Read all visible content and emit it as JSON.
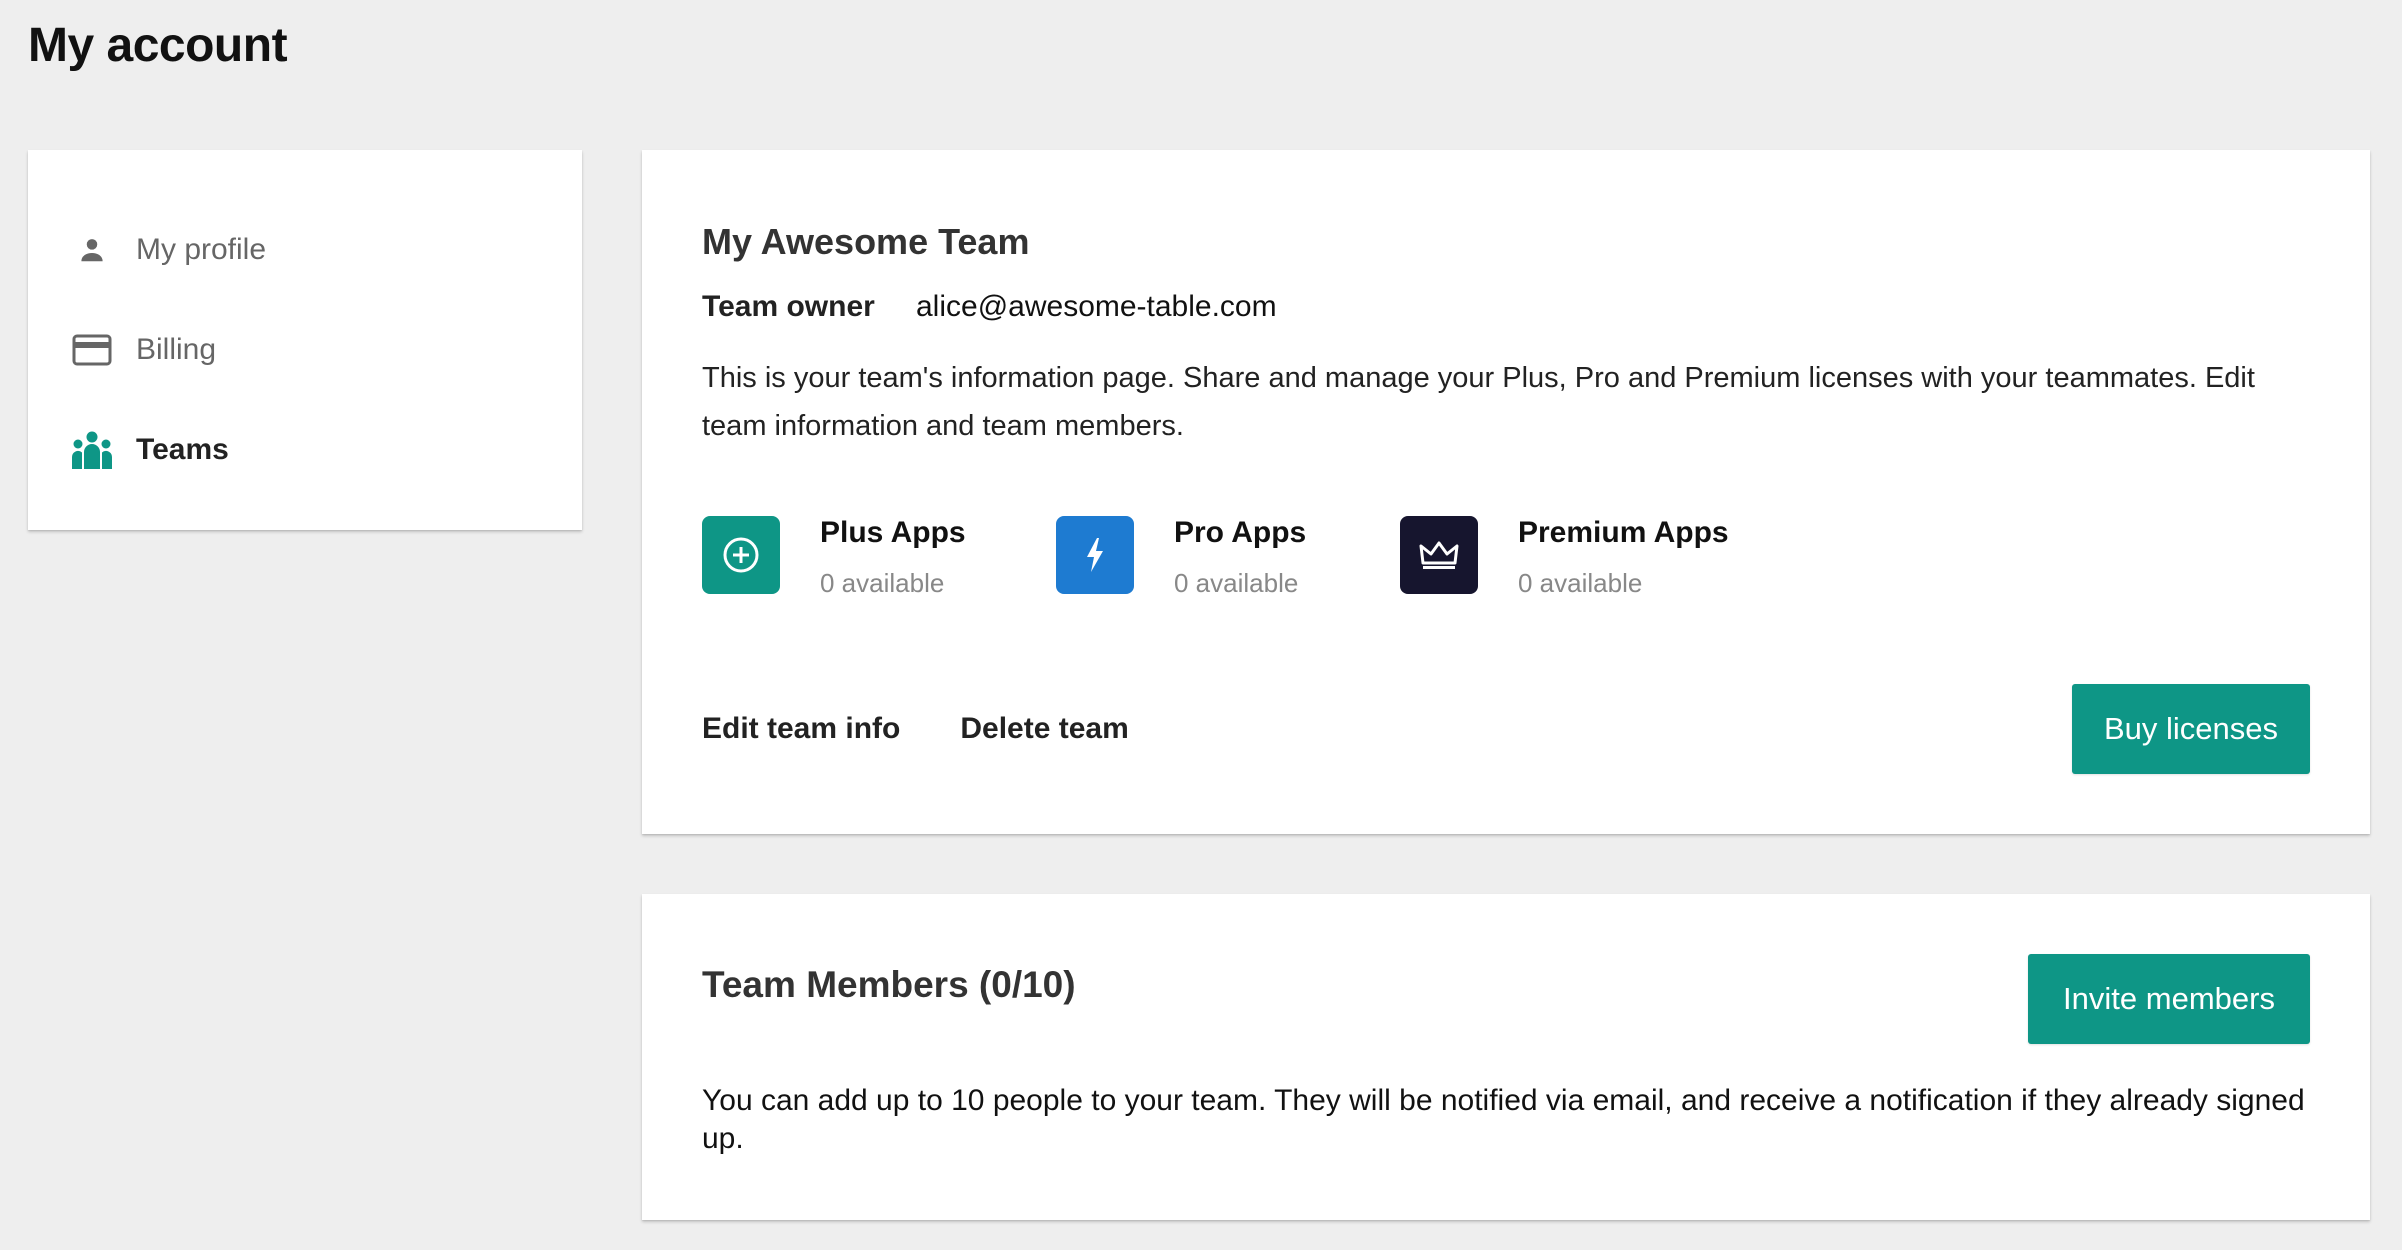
{
  "page": {
    "title": "My account"
  },
  "sidebar": {
    "items": [
      {
        "label": "My profile",
        "icon": "person-icon",
        "active": false
      },
      {
        "label": "Billing",
        "icon": "credit-card-icon",
        "active": false
      },
      {
        "label": "Teams",
        "icon": "group-icon",
        "active": true
      }
    ]
  },
  "team": {
    "name": "My Awesome Team",
    "owner_label": "Team owner",
    "owner_email": "alice@awesome-table.com",
    "description": "This is your team's information page. Share and manage your Plus, Pro and Premium licenses with your teammates. Edit team information and team members.",
    "apps": [
      {
        "name": "Plus Apps",
        "availability": "0 available",
        "icon": "plus-circle-icon",
        "color": "#0e9686"
      },
      {
        "name": "Pro Apps",
        "availability": "0 available",
        "icon": "lightning-bolt-icon",
        "color": "#1e7bd1"
      },
      {
        "name": "Premium Apps",
        "availability": "0 available",
        "icon": "crown-icon",
        "color": "#16152e"
      }
    ],
    "actions": {
      "edit_label": "Edit team info",
      "delete_label": "Delete team",
      "buy_label": "Buy licenses"
    }
  },
  "members": {
    "title": "Team Members (0/10)",
    "invite_label": "Invite members",
    "description": "You can add up to 10 people to your team. They will be notified via email, and receive a notification if they already signed up."
  },
  "colors": {
    "accent": "#0e9686",
    "background": "#eeeeee",
    "card": "#ffffff"
  }
}
